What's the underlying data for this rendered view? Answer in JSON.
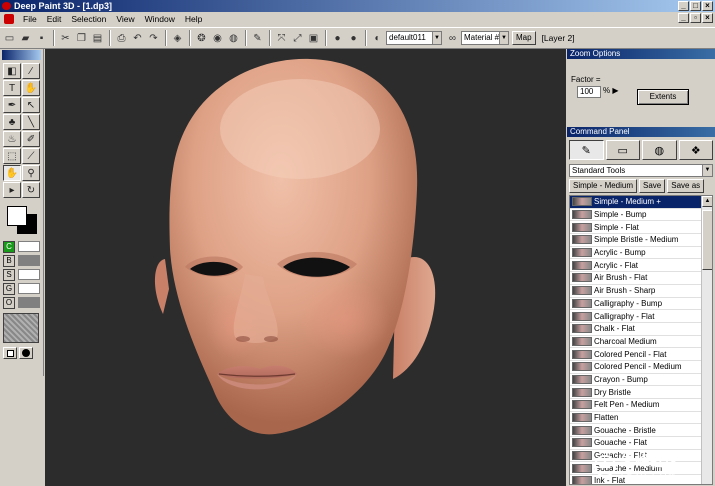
{
  "window": {
    "title": "Deep Paint 3D - [1.dp3]"
  },
  "menu": [
    "File",
    "Edit",
    "Selection",
    "View",
    "Window",
    "Help"
  ],
  "toolbar": {
    "material_preset": "default011",
    "material_field": "Material #",
    "map_label": "Map",
    "layer_label": "[Layer 2]"
  },
  "channels": [
    {
      "key": "C",
      "on": true
    },
    {
      "key": "B",
      "on": false
    },
    {
      "key": "S",
      "on": false
    },
    {
      "key": "G",
      "on": false
    },
    {
      "key": "O",
      "on": false
    }
  ],
  "zoom_options": {
    "title": "Zoom Options",
    "factor_label": "Factor =",
    "factor_value": "100",
    "unit": "%",
    "extents_button": "Extents"
  },
  "command_panel": {
    "title": "Command Panel",
    "tool_set": "Standard Tools",
    "current_preset": "Simple - Medium",
    "save_label": "Save",
    "save_as_label": "Save as",
    "brushes": [
      "Simple - Medium +",
      "Simple - Bump",
      "Simple - Flat",
      "Simple Bristle - Medium",
      "Acrylic - Bump",
      "Acrylic - Flat",
      "Air Brush - Flat",
      "Air Brush - Sharp",
      "Calligraphy - Bump",
      "Calligraphy - Flat",
      "Chalk - Flat",
      "Charcoal Medium",
      "Colored Pencil - Flat",
      "Colored Pencil - Medium",
      "Crayon - Bump",
      "Dry Bristle",
      "Felt Pen - Medium",
      "Flatten",
      "Gouache - Bristle",
      "Gouache - Flat",
      "Gouache - Flat",
      "Gouache - Medium",
      "Ink - Flat"
    ],
    "selected_index": 0
  },
  "watermark": {
    "text": "朱峰社区",
    "subtext": "ZF3D.COM"
  },
  "colors": {
    "title_gradient_start": "#0a246a",
    "canvas_bg": "#2c2c2c",
    "skin": "#e2a98e",
    "selection": "#0a246a"
  }
}
